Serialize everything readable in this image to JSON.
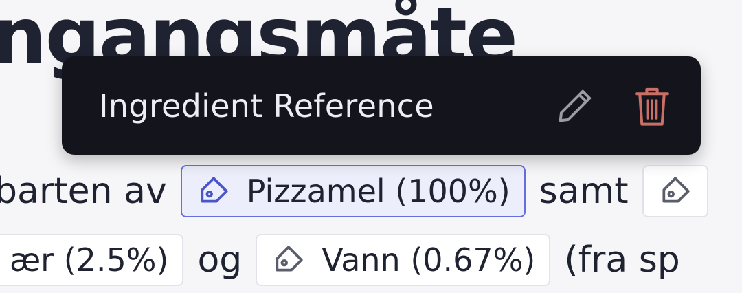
{
  "heading": {
    "text": "ngangsmåte"
  },
  "tooltip": {
    "title": "Ingredient Reference",
    "edit_icon": "pencil-icon",
    "delete_icon": "trash-icon"
  },
  "content": {
    "line1": {
      "prefix": "barten av",
      "ingredient_chip": "Pizzamel (100%)",
      "connector": "samt"
    },
    "line2": {
      "chip_partial": "ær (2.5%)",
      "connector": "og",
      "ingredient_chip": "Vann (0.67%)",
      "suffix": "(fra sp"
    }
  },
  "colors": {
    "tooltip_bg": "#13141c",
    "tooltip_text": "#eceef4",
    "delete_icon": "#c96f66",
    "edit_icon": "#9a9ca6",
    "active_chip_border": "#6470e0",
    "active_chip_bg": "#eceefb"
  }
}
